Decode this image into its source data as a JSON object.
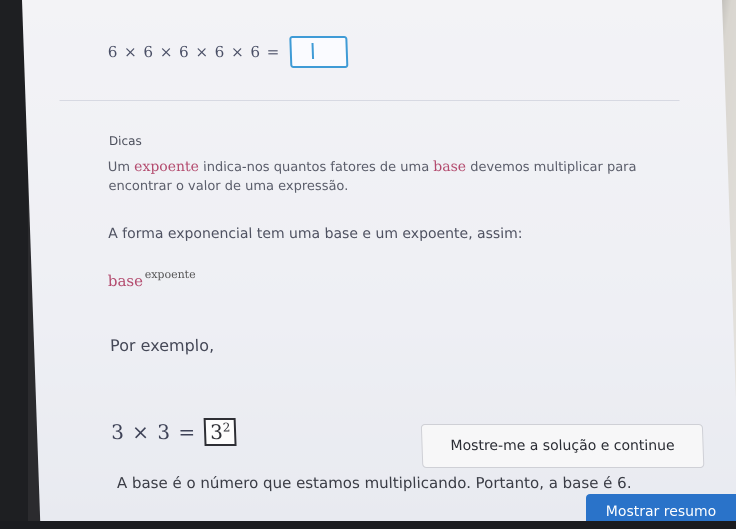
{
  "equation": {
    "expression": "6 × 6 × 6 × 6 × 6 ="
  },
  "hints": {
    "title": "Dicas",
    "para1_pre": "Um ",
    "para1_kw1": "expoente",
    "para1_mid": " indica-nos quantos fatores de uma ",
    "para1_kw2": "base",
    "para1_post": " devemos multiplicar para encontrar o valor de uma expressão.",
    "para2": "A forma exponencial tem uma base e um expoente, assim:",
    "base_word": "base",
    "exp_word": "expoente",
    "example_intro": "Por exemplo,",
    "example_lhs": "3 × 3 =",
    "example_base": "3",
    "example_exp": "2"
  },
  "buttons": {
    "solution_label": "Mostre-me a solução e continue",
    "summary_label": "Mostrar resumo"
  },
  "bottom": {
    "text": "A base é o número que estamos multiplicando. Portanto, a base é 6."
  },
  "colors": {
    "accent": "#3f9bd6",
    "keyword": "#b34b6e",
    "summary_button": "#2a73c9"
  }
}
